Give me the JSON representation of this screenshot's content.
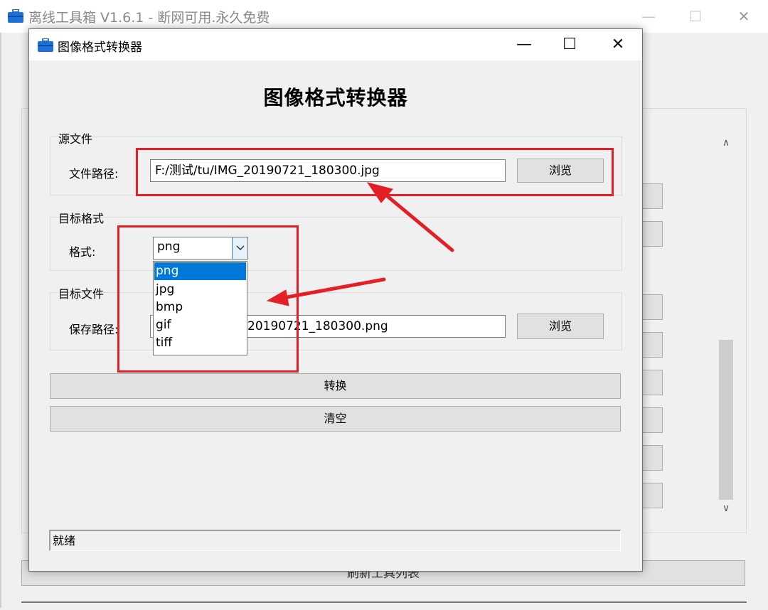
{
  "background_window": {
    "title": "离线工具箱 V1.6.1 - 断网可用.永久免费",
    "minimize": "—",
    "maximize": "☐",
    "close": "✕",
    "refresh_button": "刷新工具列表",
    "scroll_up": "∧",
    "scroll_down": "∨"
  },
  "converter": {
    "window_title": "图像格式转换器",
    "minimize": "—",
    "maximize": "☐",
    "close": "✕",
    "heading": "图像格式转换器",
    "source": {
      "group_label": "源文件",
      "path_label": "文件路径:",
      "path_value": "F:/测试/tu/IMG_20190721_180300.jpg",
      "browse": "浏览"
    },
    "format": {
      "group_label": "目标格式",
      "label": "格式:",
      "selected": "png",
      "options": [
        "png",
        "jpg",
        "bmp",
        "gif",
        "tiff"
      ]
    },
    "target": {
      "group_label": "目标文件",
      "path_label": "保存路径:",
      "path_value_visible": "20190721_180300.png",
      "browse": "浏览"
    },
    "convert_button": "转换",
    "clear_button": "清空",
    "status": "就绪"
  },
  "colors": {
    "annotation_red": "#e41f25",
    "selection_blue": "#0078d7",
    "icon_blue": "#1e6fd9"
  },
  "icons": [
    "toolbox-icon",
    "chevron-down-icon",
    "minimize-icon",
    "maximize-icon",
    "close-icon"
  ]
}
